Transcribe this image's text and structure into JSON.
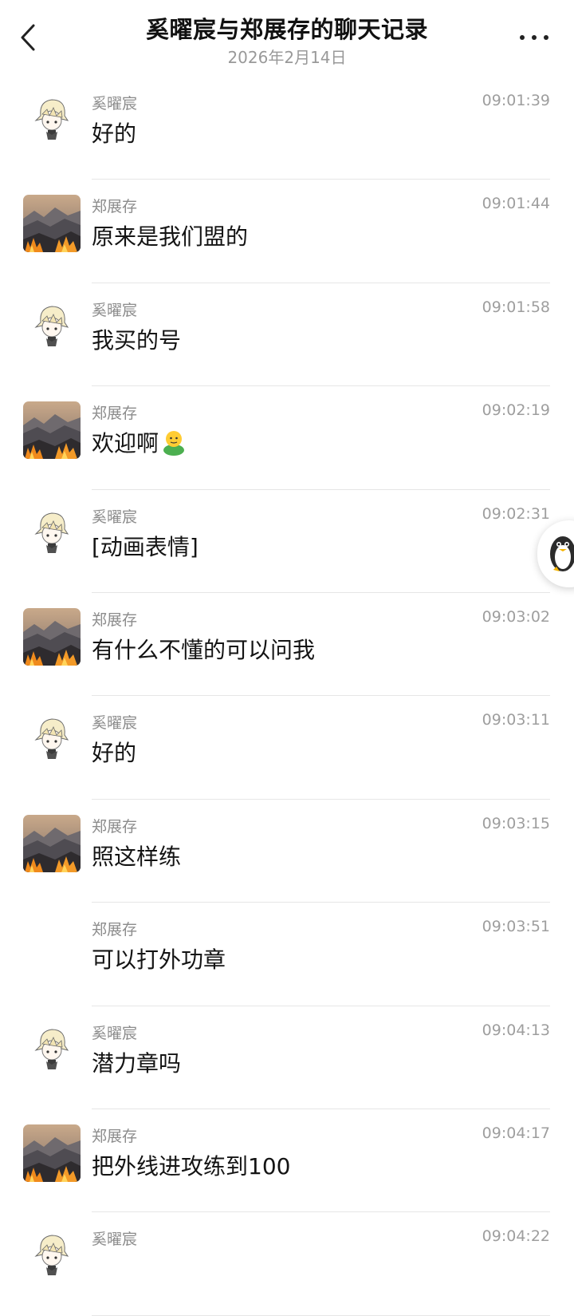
{
  "header": {
    "title": "奚曜宸与郑展存的聊天记录",
    "date": "2026年2月14日",
    "back_icon": "chevron-left-icon",
    "more_icon": "more-dots-icon"
  },
  "avatars": {
    "xi": "anime-boy-avatar",
    "zheng": "mountain-fire-avatar"
  },
  "messages": [
    {
      "sender": "奚曜宸",
      "time": "09:01:39",
      "text": "好的",
      "avatar": "xi"
    },
    {
      "sender": "郑展存",
      "time": "09:01:44",
      "text": "原来是我们盟的",
      "avatar": "zheng"
    },
    {
      "sender": "奚曜宸",
      "time": "09:01:58",
      "text": "我买的号",
      "avatar": "xi"
    },
    {
      "sender": "郑展存",
      "time": "09:02:19",
      "text": "欢迎啊",
      "avatar": "zheng",
      "emoji": "smiling-person-emoji"
    },
    {
      "sender": "奚曜宸",
      "time": "09:02:31",
      "text": "[动画表情]",
      "avatar": "xi"
    },
    {
      "sender": "郑展存",
      "time": "09:03:02",
      "text": "有什么不懂的可以问我",
      "avatar": "zheng"
    },
    {
      "sender": "奚曜宸",
      "time": "09:03:11",
      "text": "好的",
      "avatar": "xi"
    },
    {
      "sender": "郑展存",
      "time": "09:03:15",
      "text": "照这样练",
      "avatar": "zheng"
    },
    {
      "sender": "郑展存",
      "time": "09:03:51",
      "text": "可以打外功章",
      "avatar": ""
    },
    {
      "sender": "奚曜宸",
      "time": "09:04:13",
      "text": "潜力章吗",
      "avatar": "xi"
    },
    {
      "sender": "郑展存",
      "time": "09:04:17",
      "text": "把外线进攻练到100",
      "avatar": "zheng"
    },
    {
      "sender": "奚曜宸",
      "time": "09:04:22",
      "text": "",
      "avatar": "xi"
    }
  ],
  "floating": {
    "icon": "penguin-icon"
  },
  "colors": {
    "sender_text": "#8c8c8c",
    "time_text": "#9e9e9e",
    "divider": "#e6e6e6",
    "title_text": "#111111"
  }
}
